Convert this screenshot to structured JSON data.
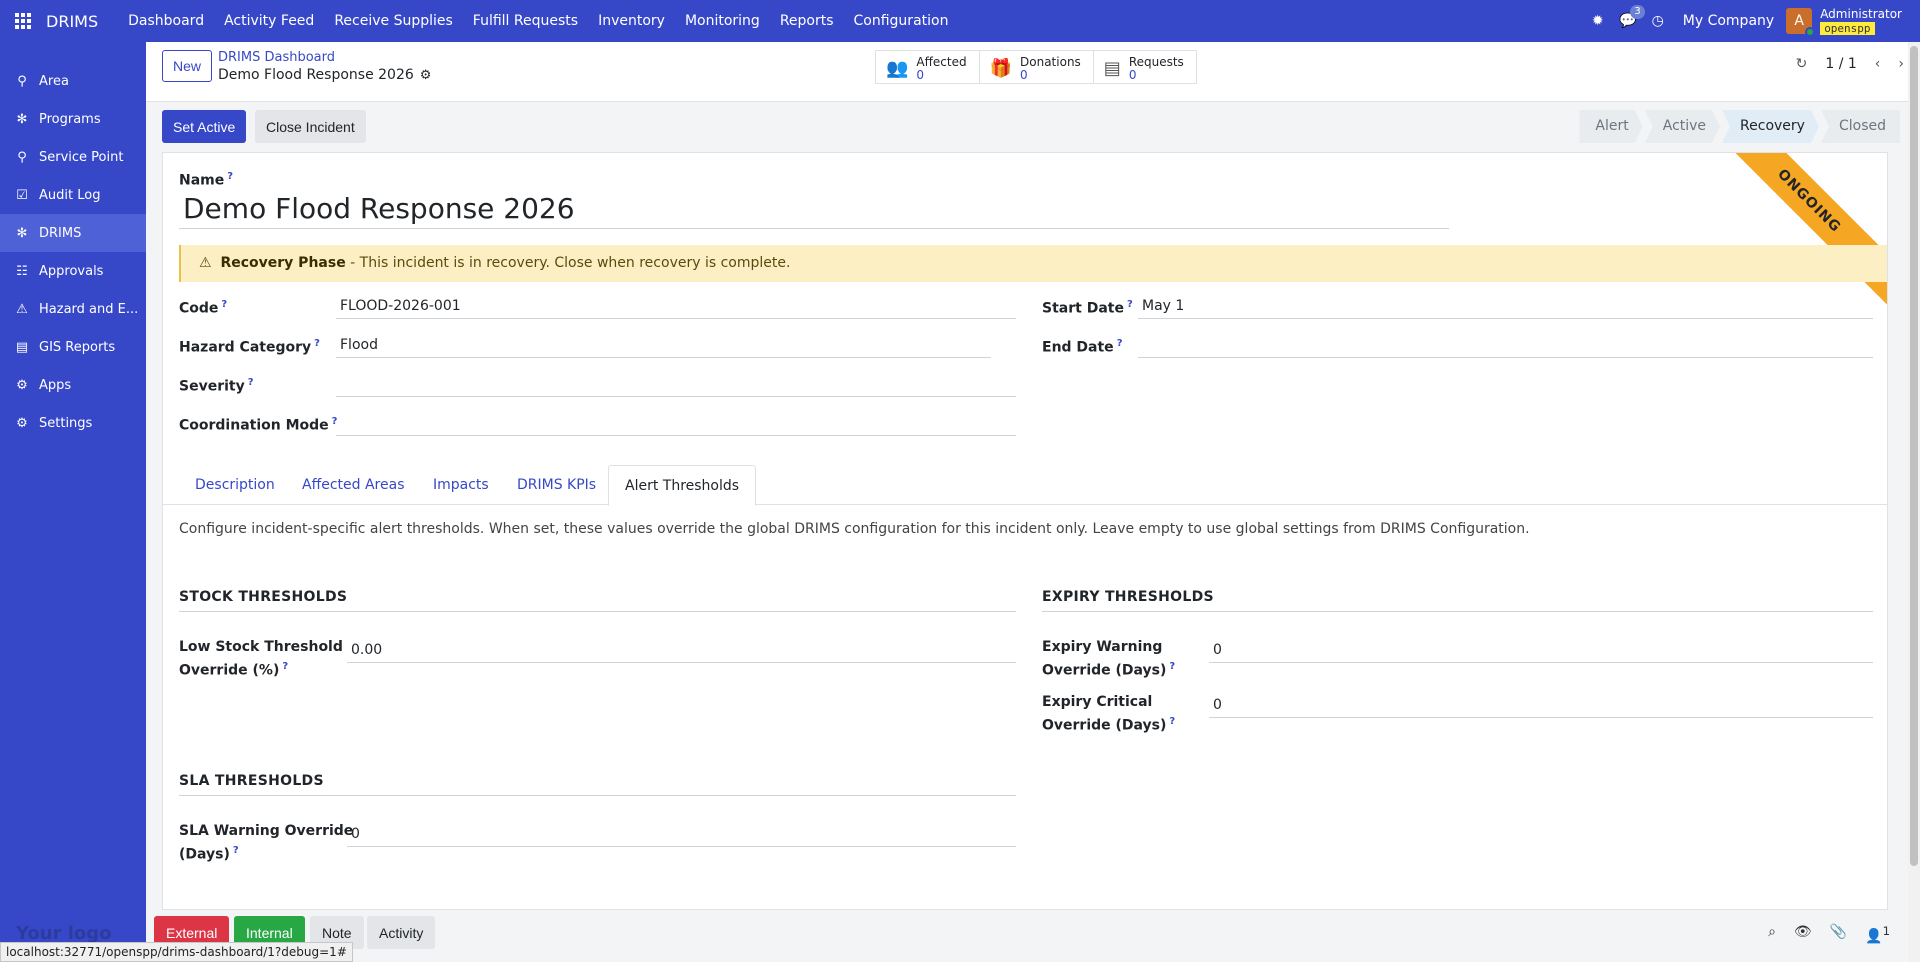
{
  "topbar": {
    "brand": "DRIMS",
    "menu": [
      "Dashboard",
      "Activity Feed",
      "Receive Supplies",
      "Fulfill Requests",
      "Inventory",
      "Monitoring",
      "Reports",
      "Configuration"
    ],
    "messages_count": "3",
    "company": "My Company",
    "avatar_letter": "A",
    "username": "Administrator",
    "database": "openspp"
  },
  "sidebar": {
    "items": [
      {
        "label": "Area",
        "icon": "area-icon"
      },
      {
        "label": "Programs",
        "icon": "programs-icon"
      },
      {
        "label": "Service Point",
        "icon": "service-point-icon"
      },
      {
        "label": "Audit Log",
        "icon": "audit-log-icon"
      },
      {
        "label": "DRIMS",
        "icon": "drims-icon"
      },
      {
        "label": "Approvals",
        "icon": "approvals-icon"
      },
      {
        "label": "Hazard and E...",
        "icon": "hazard-icon"
      },
      {
        "label": "GIS Reports",
        "icon": "gis-reports-icon"
      },
      {
        "label": "Apps",
        "icon": "apps-icon"
      },
      {
        "label": "Settings",
        "icon": "settings-icon"
      }
    ],
    "active_index": 4,
    "logo_text": "Your logo"
  },
  "control_panel": {
    "new_label": "New",
    "breadcrumb_parent": "DRIMS Dashboard",
    "breadcrumb_current": "Demo Flood Response 2026",
    "stats": [
      {
        "label": "Affected",
        "value": "0"
      },
      {
        "label": "Donations",
        "value": "0"
      },
      {
        "label": "Requests",
        "value": "0"
      }
    ],
    "pager": "1 / 1"
  },
  "status_bar": {
    "set_active_label": "Set Active",
    "close_incident_label": "Close Incident",
    "stages": [
      "Alert",
      "Active",
      "Recovery",
      "Closed"
    ],
    "current_stage": "Recovery"
  },
  "form": {
    "ribbon": "ONGOING",
    "name_label": "Name",
    "name_value": "Demo Flood Response 2026",
    "alert_bold": "Recovery Phase",
    "alert_text": " - This incident is in recovery. Close when recovery is complete.",
    "code_label": "Code",
    "code_value": "FLOOD-2026-001",
    "hazard_label": "Hazard Category",
    "hazard_value": "Flood",
    "severity_label": "Severity",
    "severity_value": "",
    "coordination_label": "Coordination Mode",
    "coordination_value": "",
    "start_date_label": "Start Date",
    "start_date_value": "May 1",
    "end_date_label": "End Date",
    "end_date_value": ""
  },
  "tabs": [
    "Description",
    "Affected Areas",
    "Impacts",
    "DRIMS KPIs",
    "Alert Thresholds"
  ],
  "active_tab": "Alert Thresholds",
  "thresholds": {
    "description": "Configure incident-specific alert thresholds. When set, these values override the global DRIMS configuration for this incident only. Leave empty to use global settings from DRIMS Configuration.",
    "stock_title": "STOCK THRESHOLDS",
    "low_stock_label_1": "Low Stock Threshold",
    "low_stock_label_2": "Override (%)",
    "low_stock_value": "0.00",
    "expiry_title": "EXPIRY THRESHOLDS",
    "expiry_warning_label_1": "Expiry Warning",
    "expiry_warning_label_2": "Override (Days)",
    "expiry_warning_value": "0",
    "expiry_critical_label_1": "Expiry Critical",
    "expiry_critical_label_2": "Override (Days)",
    "expiry_critical_value": "0",
    "sla_title": "SLA THRESHOLDS",
    "sla_warning_label_1": "SLA Warning Override",
    "sla_warning_label_2": "(Days)",
    "sla_warning_value": "0"
  },
  "chatter": {
    "external": "External",
    "internal": "Internal",
    "note": "Note",
    "activity": "Activity",
    "followers_count": "1"
  },
  "status_url": "localhost:32771/openspp/drims-dashboard/1?debug=1#",
  "colors": {
    "primary": "#3648c8",
    "ribbon": "#f5a623",
    "alert_bg": "#fcefc4",
    "external": "#dc3545",
    "internal": "#28a745"
  }
}
